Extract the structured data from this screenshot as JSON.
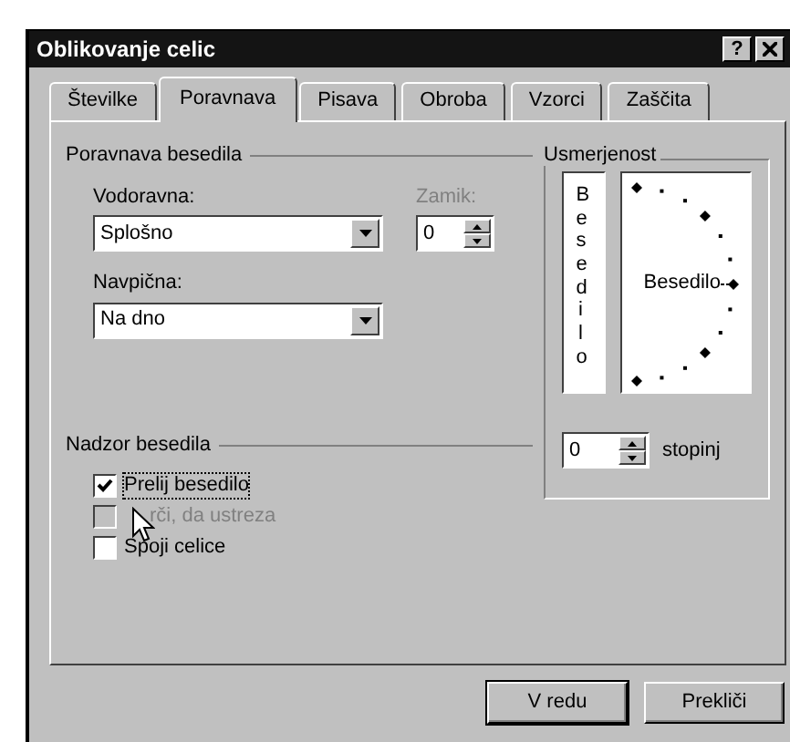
{
  "window": {
    "title": "Oblikovanje celic",
    "help_button": "?"
  },
  "tabs": [
    {
      "label": "Številke",
      "selected": false
    },
    {
      "label": "Poravnava",
      "selected": true
    },
    {
      "label": "Pisava",
      "selected": false
    },
    {
      "label": "Obroba",
      "selected": false
    },
    {
      "label": "Vzorci",
      "selected": false
    },
    {
      "label": "Zaščita",
      "selected": false
    }
  ],
  "text_alignment": {
    "title": "Poravnava besedila",
    "horizontal": {
      "label": "Vodoravna:",
      "value": "Splošno"
    },
    "indent": {
      "label": "Zamik:",
      "value": "0",
      "disabled": true
    },
    "vertical": {
      "label": "Navpična:",
      "value": "Na dno"
    }
  },
  "orientation": {
    "title": "Usmerjenost",
    "vertical_text": "Besedilo",
    "dial_text": "Besedilo",
    "degrees": {
      "value": "0",
      "unit": "stopinj"
    }
  },
  "text_control": {
    "title": "Nadzor besedila",
    "options": [
      {
        "label": "Prelij besedilo",
        "checked": true,
        "disabled": false,
        "focused": true
      },
      {
        "label": "rči, da ustreza",
        "checked": false,
        "disabled": true,
        "focused": false
      },
      {
        "label": "Spoji celice",
        "checked": false,
        "disabled": false,
        "focused": false
      }
    ]
  },
  "buttons": [
    "V redu",
    "Prekliči"
  ]
}
